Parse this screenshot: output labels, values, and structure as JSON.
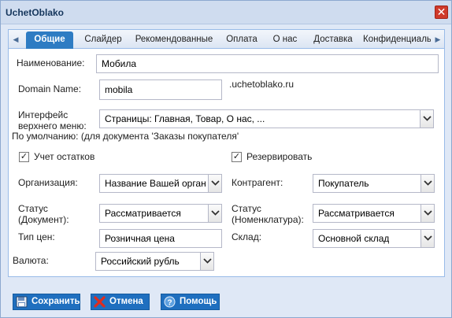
{
  "window": {
    "title": "UchetOblako",
    "close_label": "✕"
  },
  "tabs": [
    {
      "label": "Общие"
    },
    {
      "label": "Слайдер"
    },
    {
      "label": "Рекомендованные"
    },
    {
      "label": "Оплата"
    },
    {
      "label": "О нас"
    },
    {
      "label": "Доставка"
    },
    {
      "label": "Конфиденциальность"
    }
  ],
  "form": {
    "name_label": "Наименование:",
    "name_value": "Мобила",
    "domain_label": "Domain Name:",
    "domain_value": "mobila",
    "domain_suffix": ".uchetoblako.ru",
    "menu_label_line1": "Интерфейс",
    "menu_label_line2": "верхнего меню:",
    "menu_value": "Страницы: Главная, Товар, О нас, ...",
    "default_hint": "По умолчанию: (для документа 'Заказы покупателя'",
    "stock_label": "Учет остатков",
    "stock_checked": true,
    "reserve_label": "Резервировать",
    "reserve_checked": true,
    "org_label": "Организация:",
    "org_value": "Название Вашей организации",
    "counterparty_label": "Контрагент:",
    "counterparty_value": "Покупатель",
    "status_doc_label_line1": "Статус",
    "status_doc_label_line2": "(Документ):",
    "status_doc_value": "Рассматривается",
    "status_nom_label_line1": "Статус",
    "status_nom_label_line2": "(Номенклатура):",
    "status_nom_value": "Рассматривается",
    "price_type_label": "Тип цен:",
    "price_type_value": "Розничная цена",
    "warehouse_label": "Склад:",
    "warehouse_value": "Основной склад",
    "currency_label": "Валюта:",
    "currency_value": "Российский рубль"
  },
  "buttons": {
    "save": "Сохранить",
    "cancel": "Отмена",
    "help": "Помощь"
  },
  "colors": {
    "accent": "#2e7cc3",
    "button": "#1f6fbf",
    "close": "#cf3a2a"
  }
}
